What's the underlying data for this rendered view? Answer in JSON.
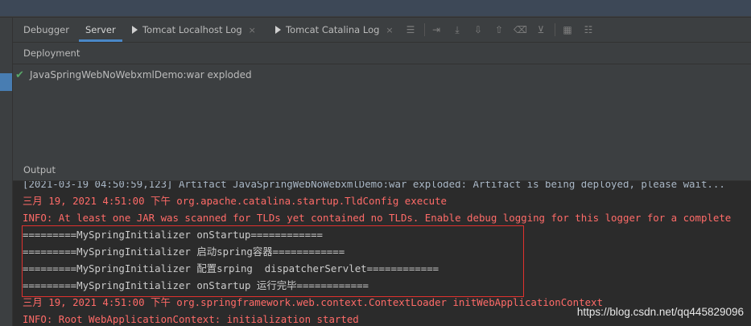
{
  "colors": {
    "console_info": "#ff6b68",
    "console_stdout": "#cccccc",
    "deployment_ok": "#59a869",
    "highlight_box": "#e0312e",
    "active_tab_underline": "#4a88c7"
  },
  "tabs": [
    {
      "label": "Debugger",
      "close": ""
    },
    {
      "label": "Server",
      "close": ""
    },
    {
      "label": "Tomcat Localhost Log",
      "close": "×"
    },
    {
      "label": "Tomcat Catalina Log",
      "close": "×"
    }
  ],
  "toolbar_icons": [
    "menu-icon",
    "soft-wrap-icon",
    "scroll-to-end-icon",
    "download-icon",
    "upload-icon",
    "clear-icon",
    "filter-icon",
    "print-icon",
    "settings-icon"
  ],
  "deployment": {
    "header": "Deployment",
    "items": [
      {
        "status_icon": "check-icon",
        "label": "JavaSpringWebNoWebxmlDemo:war exploded"
      }
    ]
  },
  "output": {
    "header": "Output",
    "lines": [
      {
        "text": "[2021-03-19 04:50:59,123] Artifact JavaSpringWebNoWebxmlDemo:war exploded: Artifact is being deployed, please wait...",
        "kind": "gray"
      },
      {
        "text": "三月 19, 2021 4:51:00 下午 org.apache.catalina.startup.TldConfig execute",
        "kind": "red"
      },
      {
        "text": "INFO: At least one JAR was scanned for TLDs yet contained no TLDs. Enable debug logging for this logger for a complete",
        "kind": "red"
      },
      {
        "text": "=========MySpringInitializer onStartup============",
        "kind": "white"
      },
      {
        "text": "=========MySpringInitializer 启动spring容器============",
        "kind": "white"
      },
      {
        "text": "=========MySpringInitializer 配置srping  dispatcherServlet============",
        "kind": "white"
      },
      {
        "text": "=========MySpringInitializer onStartup 运行完毕============",
        "kind": "white"
      },
      {
        "text": "三月 19, 2021 4:51:00 下午 org.springframework.web.context.ContextLoader initWebApplicationContext",
        "kind": "red"
      },
      {
        "text": "INFO: Root WebApplicationContext: initialization started",
        "kind": "red"
      }
    ]
  },
  "watermark": "https://blog.csdn.net/qq445829096"
}
